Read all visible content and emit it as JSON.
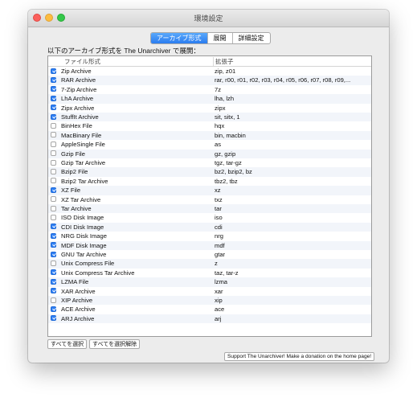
{
  "window": {
    "title": "環境設定"
  },
  "tabs": [
    {
      "label": "アーカイブ形式",
      "active": true
    },
    {
      "label": "展開",
      "active": false
    },
    {
      "label": "詳細設定",
      "active": false
    }
  ],
  "intro_text": "以下のアーカイブ形式を The Unarchiver で展開：",
  "table": {
    "headers": {
      "name": "ファイル形式",
      "ext": "拡張子"
    },
    "rows": [
      {
        "checked": true,
        "name": "Zip Archive",
        "ext": "zip, z01"
      },
      {
        "checked": true,
        "name": "RAR Archive",
        "ext": "rar, r00, r01, r02, r03, r04, r05, r06, r07, r08, r09,..."
      },
      {
        "checked": true,
        "name": "7-Zip Archive",
        "ext": "7z"
      },
      {
        "checked": true,
        "name": "LhA Archive",
        "ext": "lha, lzh"
      },
      {
        "checked": true,
        "name": "Zipx Archive",
        "ext": "zipx"
      },
      {
        "checked": true,
        "name": "StuffIt Archive",
        "ext": "sit, sitx, 1"
      },
      {
        "checked": false,
        "name": "BinHex File",
        "ext": "hqx"
      },
      {
        "checked": false,
        "name": "MacBinary File",
        "ext": "bin, macbin"
      },
      {
        "checked": false,
        "name": "AppleSingle File",
        "ext": "as"
      },
      {
        "checked": false,
        "name": "Gzip File",
        "ext": "gz, gzip"
      },
      {
        "checked": false,
        "name": "Gzip Tar Archive",
        "ext": "tgz, tar-gz"
      },
      {
        "checked": false,
        "name": "Bzip2 File",
        "ext": "bz2, bzip2, bz"
      },
      {
        "checked": false,
        "name": "Bzip2 Tar Archive",
        "ext": "tbz2, tbz"
      },
      {
        "checked": true,
        "name": "XZ File",
        "ext": "xz"
      },
      {
        "checked": false,
        "name": "XZ Tar Archive",
        "ext": "txz"
      },
      {
        "checked": false,
        "name": "Tar Archive",
        "ext": "tar"
      },
      {
        "checked": false,
        "name": "ISO Disk Image",
        "ext": "iso"
      },
      {
        "checked": true,
        "name": "CDI Disk Image",
        "ext": "cdi"
      },
      {
        "checked": true,
        "name": "NRG Disk Image",
        "ext": "nrg"
      },
      {
        "checked": true,
        "name": "MDF Disk Image",
        "ext": "mdf"
      },
      {
        "checked": true,
        "name": "GNU Tar Archive",
        "ext": "gtar"
      },
      {
        "checked": false,
        "name": "Unix Compress File",
        "ext": "z"
      },
      {
        "checked": true,
        "name": "Unix Compress Tar Archive",
        "ext": "taz, tar-z"
      },
      {
        "checked": true,
        "name": "LZMA File",
        "ext": "lzma"
      },
      {
        "checked": true,
        "name": "XAR Archive",
        "ext": "xar"
      },
      {
        "checked": false,
        "name": "XIP Archive",
        "ext": "xip"
      },
      {
        "checked": true,
        "name": "ACE Archive",
        "ext": "ace"
      },
      {
        "checked": true,
        "name": "ARJ Archive",
        "ext": "arj"
      }
    ]
  },
  "buttons": {
    "select_all": "すべてを選択",
    "deselect_all": "すべてを選択解除",
    "donate": "Support The Unarchiver! Make a donation on the home page!"
  },
  "colors": {
    "accent": "#2f7ff3",
    "window_bg": "#ececec",
    "stripe": "#f2f5fa"
  }
}
